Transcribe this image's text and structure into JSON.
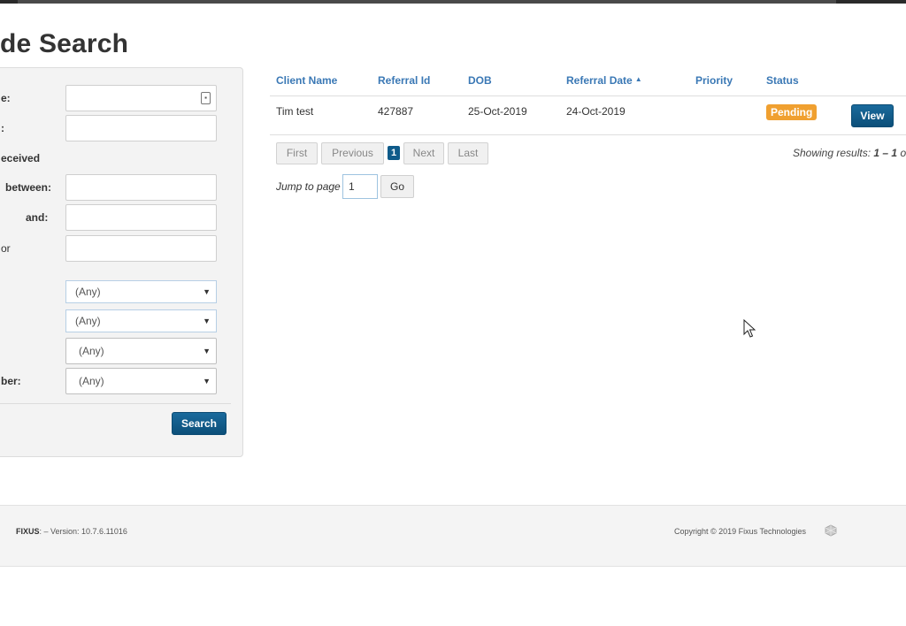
{
  "page": {
    "title": "de Search"
  },
  "search_panel": {
    "labels": {
      "field1": "e:",
      "field2": ":",
      "received_heading": "eceived",
      "between": "between:",
      "and": "and:",
      "or": "or",
      "number": "ber:"
    },
    "inputs": {
      "field1_value": "",
      "field2_value": "",
      "between_value": "",
      "and_value": "",
      "or_value": ""
    },
    "selects": [
      {
        "value": "(Any)"
      },
      {
        "value": "(Any)"
      },
      {
        "value": "(Any)"
      },
      {
        "value": "(Any)"
      }
    ],
    "search_button": "Search"
  },
  "results": {
    "columns": [
      "Client Name",
      "Referral Id",
      "DOB",
      "Referral Date",
      "Priority",
      "Status"
    ],
    "sorted_column": "Referral Date",
    "rows": [
      {
        "client_name": "Tim test",
        "referral_id": "427887",
        "dob": "25-Oct-2019",
        "referral_date": "24-Oct-2019",
        "priority": "",
        "status": "Pending",
        "action": "View"
      }
    ]
  },
  "pager": {
    "first": "First",
    "previous": "Previous",
    "current_page": "1",
    "next": "Next",
    "last": "Last",
    "showing_prefix": "Showing results:",
    "showing_range": "1 – 1",
    "showing_suffix": "o",
    "jump_label": "Jump to page",
    "jump_value": "1",
    "go": "Go"
  },
  "footer": {
    "brand": "FIXUS",
    "version_text": ": – Version: 10.7.6.11016",
    "copyright": "Copyright © 2019 Fixus Technologies"
  },
  "colors": {
    "link_blue": "#3a78b5",
    "primary_button": "#0f5b8a",
    "pending_badge": "#f0a030"
  }
}
